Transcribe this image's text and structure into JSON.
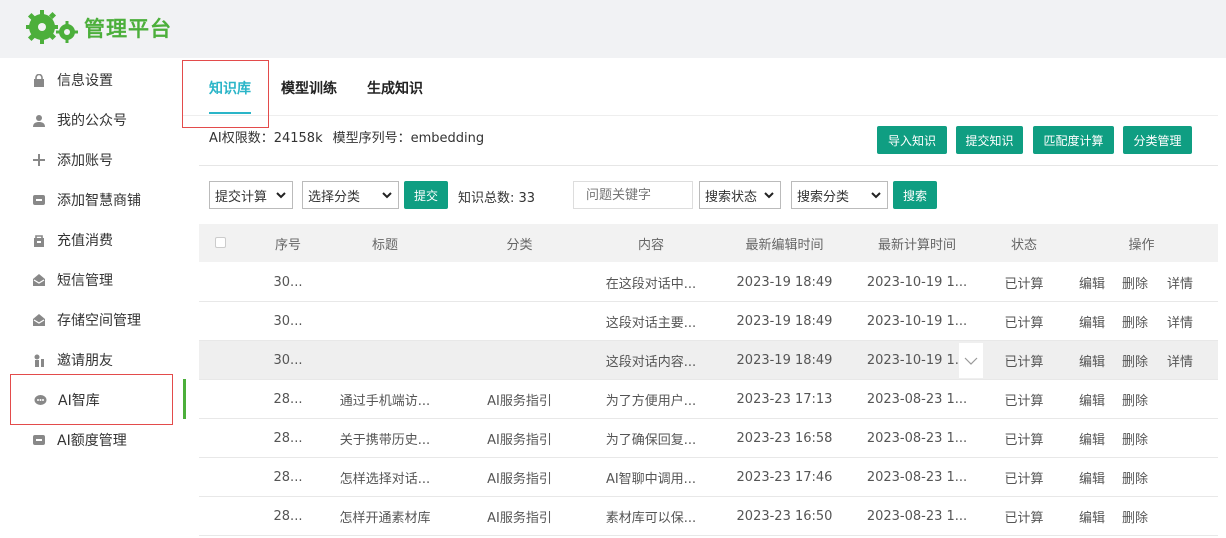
{
  "brand": "管理平台",
  "sidebar": {
    "items": [
      {
        "label": "信息设置",
        "icon": "lock-icon"
      },
      {
        "label": "我的公众号",
        "icon": "user-icon"
      },
      {
        "label": "添加账号",
        "icon": "plus-icon"
      },
      {
        "label": "添加智慧商铺",
        "icon": "box-icon"
      },
      {
        "label": "充值消费",
        "icon": "bag-icon"
      },
      {
        "label": "短信管理",
        "icon": "mail-icon"
      },
      {
        "label": "存储空间管理",
        "icon": "mail-icon"
      },
      {
        "label": "邀请朋友",
        "icon": "invite-icon"
      },
      {
        "label": "AI智库",
        "icon": "ai-icon",
        "active": true
      },
      {
        "label": "AI额度管理",
        "icon": "box-icon"
      }
    ]
  },
  "tabs": [
    {
      "label": "知识库",
      "active": true
    },
    {
      "label": "模型训练"
    },
    {
      "label": "生成知识"
    }
  ],
  "meta": {
    "limit": "AI权限数：24158k",
    "model": "模型序列号：embedding"
  },
  "actions": {
    "import": "导入知识",
    "submit": "提交知识",
    "match": "匹配度计算",
    "category": "分类管理"
  },
  "filters": {
    "compute": "提交计算",
    "category": "选择分类",
    "submit_btn": "提交",
    "count_label": "知识总数:  33",
    "keyword_placeholder": "问题关键字",
    "status": "搜索状态",
    "search_category": "搜索分类",
    "search_btn": "搜索"
  },
  "table": {
    "headers": [
      "序号",
      "标题",
      "分类",
      "内容",
      "最新编辑时间",
      "最新计算时间",
      "状态",
      "操作"
    ],
    "actions": {
      "edit": "编辑",
      "delete": "删除",
      "detail": "详情"
    },
    "rows": [
      {
        "id": "30...",
        "title": "",
        "category": "",
        "content": "在这段对话中...",
        "edited": "2023-19 18:49",
        "computed": "2023-10-19 1...",
        "status": "已计算",
        "has_detail": true
      },
      {
        "id": "30...",
        "title": "",
        "category": "",
        "content": "这段对话主要...",
        "edited": "2023-19 18:49",
        "computed": "2023-10-19 1...",
        "status": "已计算",
        "has_detail": true
      },
      {
        "id": "30...",
        "title": "",
        "category": "",
        "content": "这段对话内容...",
        "edited": "2023-19 18:49",
        "computed": "2023-10-19 1...",
        "status": "已计算",
        "has_detail": true,
        "hover": true
      },
      {
        "id": "28...",
        "title": "通过手机端访...",
        "category": "AI服务指引",
        "content": "为了方便用户...",
        "edited": "2023-23 17:13",
        "computed": "2023-08-23 1...",
        "status": "已计算",
        "has_detail": false
      },
      {
        "id": "28...",
        "title": "关于携带历史...",
        "category": "AI服务指引",
        "content": "为了确保回复...",
        "edited": "2023-23 16:58",
        "computed": "2023-08-23 1...",
        "status": "已计算",
        "has_detail": false
      },
      {
        "id": "28...",
        "title": "怎样选择对话...",
        "category": "AI服务指引",
        "content": "AI智聊中调用...",
        "edited": "2023-23 17:46",
        "computed": "2023-08-23 1...",
        "status": "已计算",
        "has_detail": false
      },
      {
        "id": "28...",
        "title": "怎样开通素材库",
        "category": "AI服务指引",
        "content": "素材库可以保...",
        "edited": "2023-23 16:50",
        "computed": "2023-08-23 1...",
        "status": "已计算",
        "has_detail": false
      }
    ]
  },
  "colors": {
    "brand": "#4caf3b",
    "accent": "#0f9e82",
    "tab_active": "#2bb5c8",
    "highlight": "#e34b4b"
  }
}
